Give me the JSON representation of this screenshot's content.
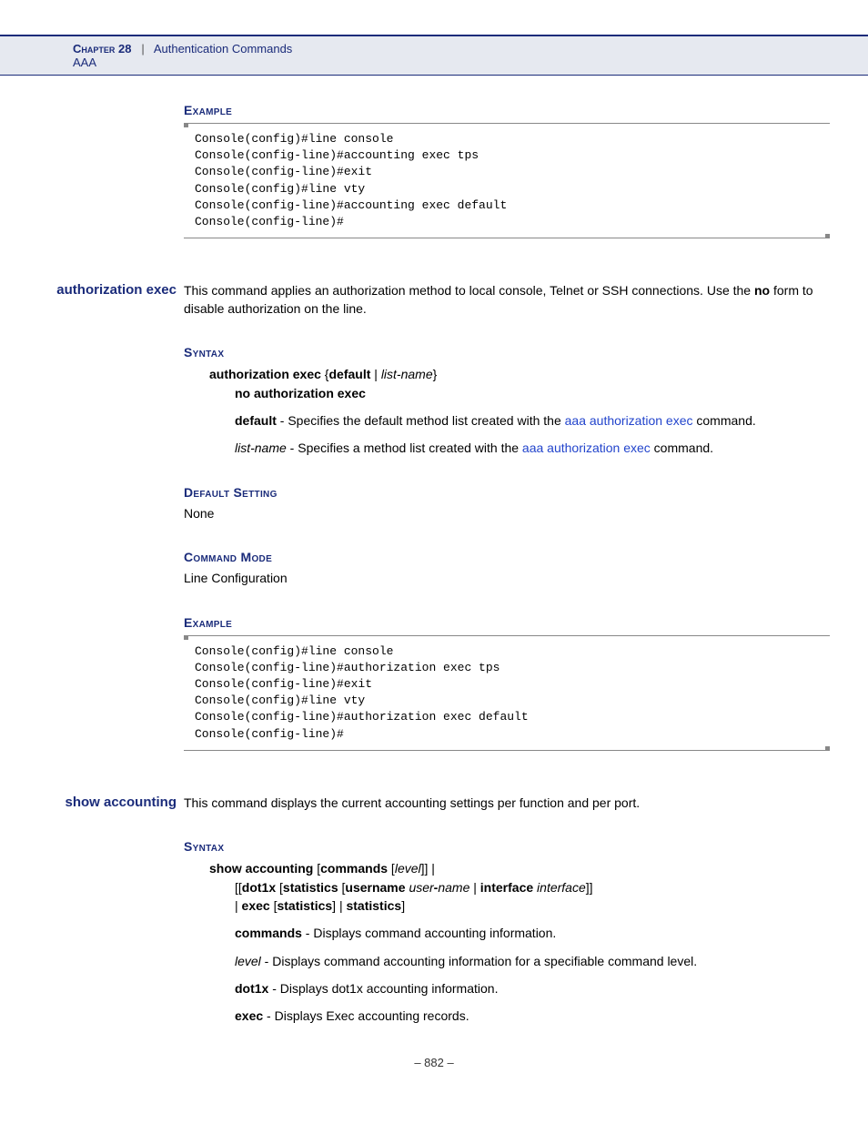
{
  "header": {
    "chapter": "Chapter 28",
    "sep": "|",
    "title": "Authentication Commands",
    "sub": "AAA"
  },
  "sec1": {
    "example_label": "Example",
    "code": "Console(config)#line console\nConsole(config-line)#accounting exec tps\nConsole(config-line)#exit\nConsole(config)#line vty\nConsole(config-line)#accounting exec default\nConsole(config-line)#"
  },
  "cmd_auth": {
    "name": "authorization exec",
    "desc_a": "This command applies an authorization method to local console, Telnet or SSH connections. Use the ",
    "desc_no": "no",
    "desc_b": " form to disable authorization on the line.",
    "syntax_label": "Syntax",
    "syntax_line1_a": "authorization exec",
    "syntax_line1_b": " {",
    "syntax_line1_c": "default",
    "syntax_line1_d": " | ",
    "syntax_line1_e": "list-name",
    "syntax_line1_f": "}",
    "syntax_line2": "no authorization exec",
    "p_default_b": "default",
    "p_default_t1": " - Specifies the default method list created with the ",
    "p_default_link": "aaa authorization exec",
    "p_default_t2": " command.",
    "p_list_i": "list-name",
    "p_list_t1": " - Specifies a method list created with the ",
    "p_list_link": "aaa authorization exec",
    "p_list_t2": " command.",
    "defset_label": "Default Setting",
    "defset_value": "None",
    "mode_label": "Command Mode",
    "mode_value": "Line Configuration",
    "example_label": "Example",
    "code": "Console(config)#line console\nConsole(config-line)#authorization exec tps\nConsole(config-line)#exit\nConsole(config)#line vty\nConsole(config-line)#authorization exec default\nConsole(config-line)#"
  },
  "cmd_show": {
    "name": "show accounting",
    "desc": "This command displays the current accounting settings per function and per port.",
    "syntax_label": "Syntax",
    "s1_a": "show accounting",
    "s1_b": " [",
    "s1_c": "commands",
    "s1_d": " [",
    "s1_e": "level",
    "s1_f": "]] |",
    "s2_a": "[[",
    "s2_b": "dot1x",
    "s2_c": " [",
    "s2_d": "statistics",
    "s2_e": " [",
    "s2_f": "username",
    "s2_g": " ",
    "s2_h": "user",
    "s2_i": "-",
    "s2_j": "name",
    "s2_k": " | ",
    "s2_l": "interface",
    "s2_m": " ",
    "s2_n": "interface",
    "s2_o": "]]",
    "s3_a": "| ",
    "s3_b": "exec",
    "s3_c": " [",
    "s3_d": "statistics",
    "s3_e": "] | ",
    "s3_f": "statistics",
    "s3_g": "]",
    "p_cmds_b": "commands",
    "p_cmds_t": " - Displays command accounting information.",
    "p_level_i": "level",
    "p_level_t": " - Displays command accounting information for a specifiable command level.",
    "p_dot1x_b": "dot1x",
    "p_dot1x_t": " - Displays dot1x accounting information.",
    "p_exec_b": "exec",
    "p_exec_t": " - Displays Exec accounting records."
  },
  "footer": {
    "page": "–  882  –"
  }
}
